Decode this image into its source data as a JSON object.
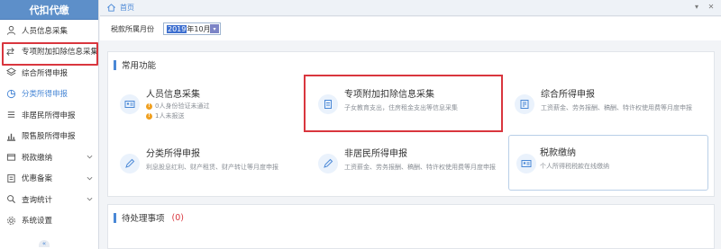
{
  "sidebar": {
    "title": "代扣代缴",
    "items": [
      {
        "label": "人员信息采集",
        "icon": "person-icon"
      },
      {
        "label": "专项附加扣除信息采集",
        "icon": "transfer-icon"
      },
      {
        "label": "综合所得申报",
        "icon": "layers-icon"
      },
      {
        "label": "分类所得申报",
        "icon": "pie-icon"
      },
      {
        "label": "非居民所得申报",
        "icon": "menu-icon"
      },
      {
        "label": "限售股所得申报",
        "icon": "bar-chart-icon"
      },
      {
        "label": "税款缴纳",
        "icon": "wallet-icon"
      },
      {
        "label": "优惠备案",
        "icon": "document-icon"
      },
      {
        "label": "查询统计",
        "icon": "search-icon"
      },
      {
        "label": "系统设置",
        "icon": "gear-icon"
      }
    ],
    "collapse_glyph": "«"
  },
  "topbar": {
    "home_label": "首页",
    "icons": [
      "chevron-down-icon",
      "close-icon"
    ]
  },
  "filter": {
    "label": "税款所属月份",
    "value_selected": "2019",
    "value_rest": "年10月"
  },
  "common": {
    "title": "常用功能",
    "cards": [
      {
        "title": "人员信息采集",
        "warn1": "0人身份验证未通过",
        "warn2": "1人未报送",
        "icon": "id-card-icon"
      },
      {
        "title": "专项附加扣除信息采集",
        "desc": "子女教育支出，住房租金支出等信息采集",
        "icon": "document-icon"
      },
      {
        "title": "综合所得申报",
        "desc": "工资薪金、劳务报酬、稿酬、特许权使用费等月度申报",
        "icon": "report-icon"
      },
      {
        "title": "分类所得申报",
        "desc": "利息股息红利、财产租赁、财产转让等月度申报",
        "icon": "edit-icon"
      },
      {
        "title": "非居民所得申报",
        "desc": "工资薪金、劳务报酬、稿酬、特许权使用费等月度申报",
        "icon": "edit-icon"
      },
      {
        "title": "税款缴纳",
        "desc": "个人所得税税款在线缴纳",
        "icon": "card-icon"
      }
    ]
  },
  "pending": {
    "title": "待处理事项",
    "count": "(0)"
  },
  "colors": {
    "accent": "#4a88d6",
    "sidebar_header": "#5d8fc9",
    "highlight_red": "#d9363e",
    "warning": "#f0a020"
  }
}
